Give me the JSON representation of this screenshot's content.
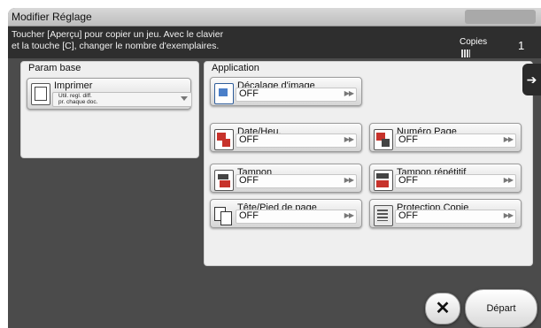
{
  "window": {
    "title": "Modifier Réglage"
  },
  "message": {
    "line1": "Toucher [Aperçu] pour copier un jeu. Avec le clavier",
    "line2": "et la touche [C], changer le nombre d'exemplaires."
  },
  "copies": {
    "label": "Copies",
    "value": "1",
    "icon": "copies-icon"
  },
  "param_base": {
    "heading": "Param base",
    "button": {
      "label": "Imprimer",
      "sub1": "Util. regl. diff.",
      "sub2": "pr. chaque doc.",
      "icon": "print-doc-icon"
    }
  },
  "application": {
    "heading": "Application",
    "items": [
      {
        "label": "Décalage d'image",
        "value": "OFF",
        "icon": "image-shift-icon"
      },
      {
        "label": "Date/Heu.",
        "value": "OFF",
        "icon": "date-time-icon"
      },
      {
        "label": "Numéro Page",
        "value": "OFF",
        "icon": "page-number-icon"
      },
      {
        "label": "Tampon",
        "value": "OFF",
        "icon": "stamp-icon"
      },
      {
        "label": "Tampon répétitif",
        "value": "OFF",
        "icon": "stamp-repeat-icon"
      },
      {
        "label": "Tête/Pied de page",
        "value": "OFF",
        "icon": "header-footer-icon"
      },
      {
        "label": "Protection Copie",
        "value": "OFF",
        "icon": "copy-protection-icon"
      }
    ]
  },
  "footer": {
    "close_label": "✕",
    "start_label": "Départ"
  },
  "colors": {
    "frame": "#4b4b4b",
    "message_bar": "#2e2e2e",
    "panel": "#efefef",
    "accent_red": "#c7322b"
  }
}
